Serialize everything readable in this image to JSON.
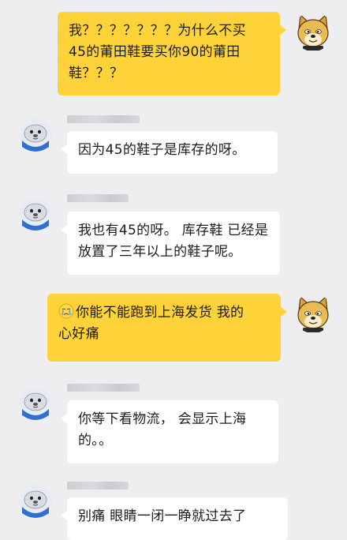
{
  "colors": {
    "background": "#eeeef0",
    "my_bubble": "#fed33a",
    "their_bubble": "#ffffff",
    "text": "#1b1b1b"
  },
  "messages": [
    {
      "sender": "me",
      "avatar_icon": "doge-avatar-icon",
      "lines": [
        "我？？？？？？？为什么不买",
        "45的莆田鞋要买你90的莆田",
        "鞋？？？"
      ]
    },
    {
      "sender": "other",
      "avatar_icon": "seal-avatar-icon",
      "nickname": "",
      "lines": [
        "因为45的鞋子是库存的呀。"
      ]
    },
    {
      "sender": "other",
      "avatar_icon": "seal-avatar-icon",
      "nickname": "",
      "lines": [
        "我也有45的呀。 库存鞋 已经是",
        "放置了三年以上的鞋子呢。"
      ]
    },
    {
      "sender": "me",
      "avatar_icon": "doge-avatar-icon",
      "emoji_icon": "crying-face-icon",
      "lines": [
        "你能不能跑到上海发货 我的",
        "心好痛"
      ]
    },
    {
      "sender": "other",
      "avatar_icon": "seal-avatar-icon",
      "nickname": "",
      "lines": [
        "你等下看物流，  会显示上海",
        "的。。"
      ]
    },
    {
      "sender": "other",
      "avatar_icon": "seal-avatar-icon",
      "nickname": "",
      "lines": [
        "别痛  眼睛一闭一睁就过去了"
      ]
    }
  ]
}
